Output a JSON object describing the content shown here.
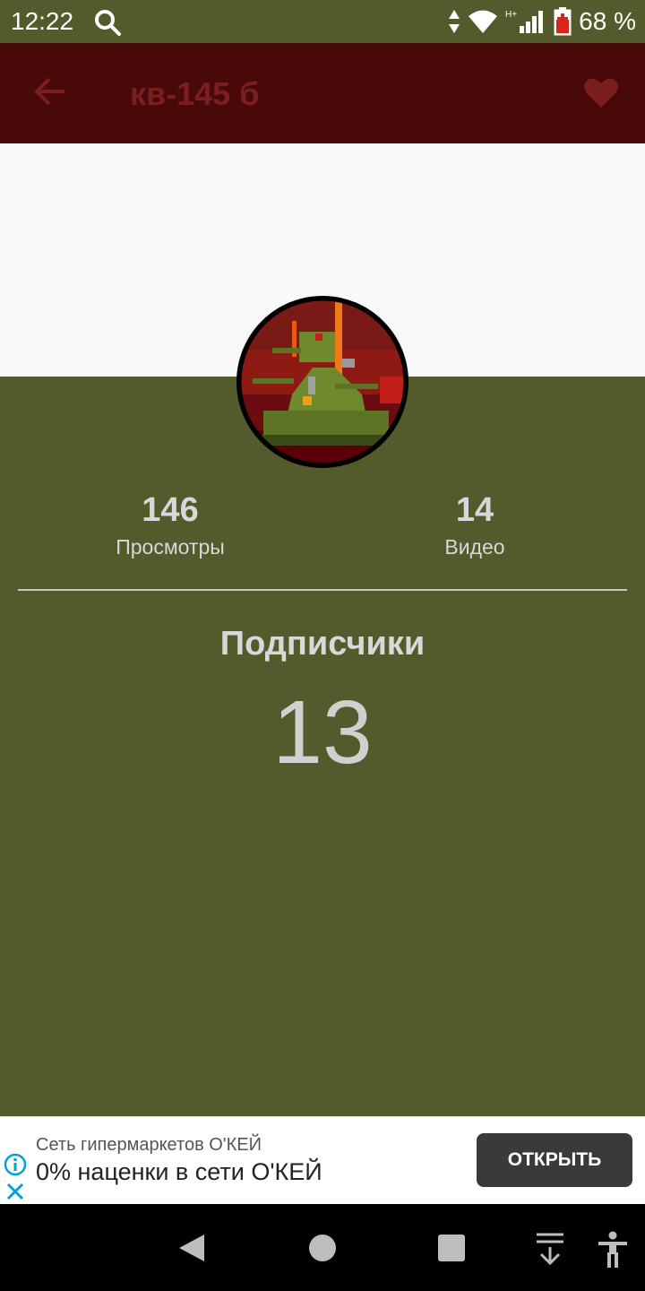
{
  "status_bar": {
    "time": "12:22",
    "battery": "68 %"
  },
  "app_bar": {
    "title": "кв-145 б"
  },
  "stats": {
    "views": {
      "value": "146",
      "label": "Просмотры"
    },
    "videos": {
      "value": "14",
      "label": "Видео"
    }
  },
  "subscribers": {
    "label": "Подписчики",
    "value": "13"
  },
  "ad": {
    "advertiser": "Сеть гипермаркетов О'КЕЙ",
    "headline": "0% наценки в сети О'КЕЙ",
    "cta_label": "ОТКРЫТЬ"
  },
  "colors": {
    "app_bar": "#4a0909",
    "background": "#535a2b",
    "header_band": "#f9f9f9"
  }
}
